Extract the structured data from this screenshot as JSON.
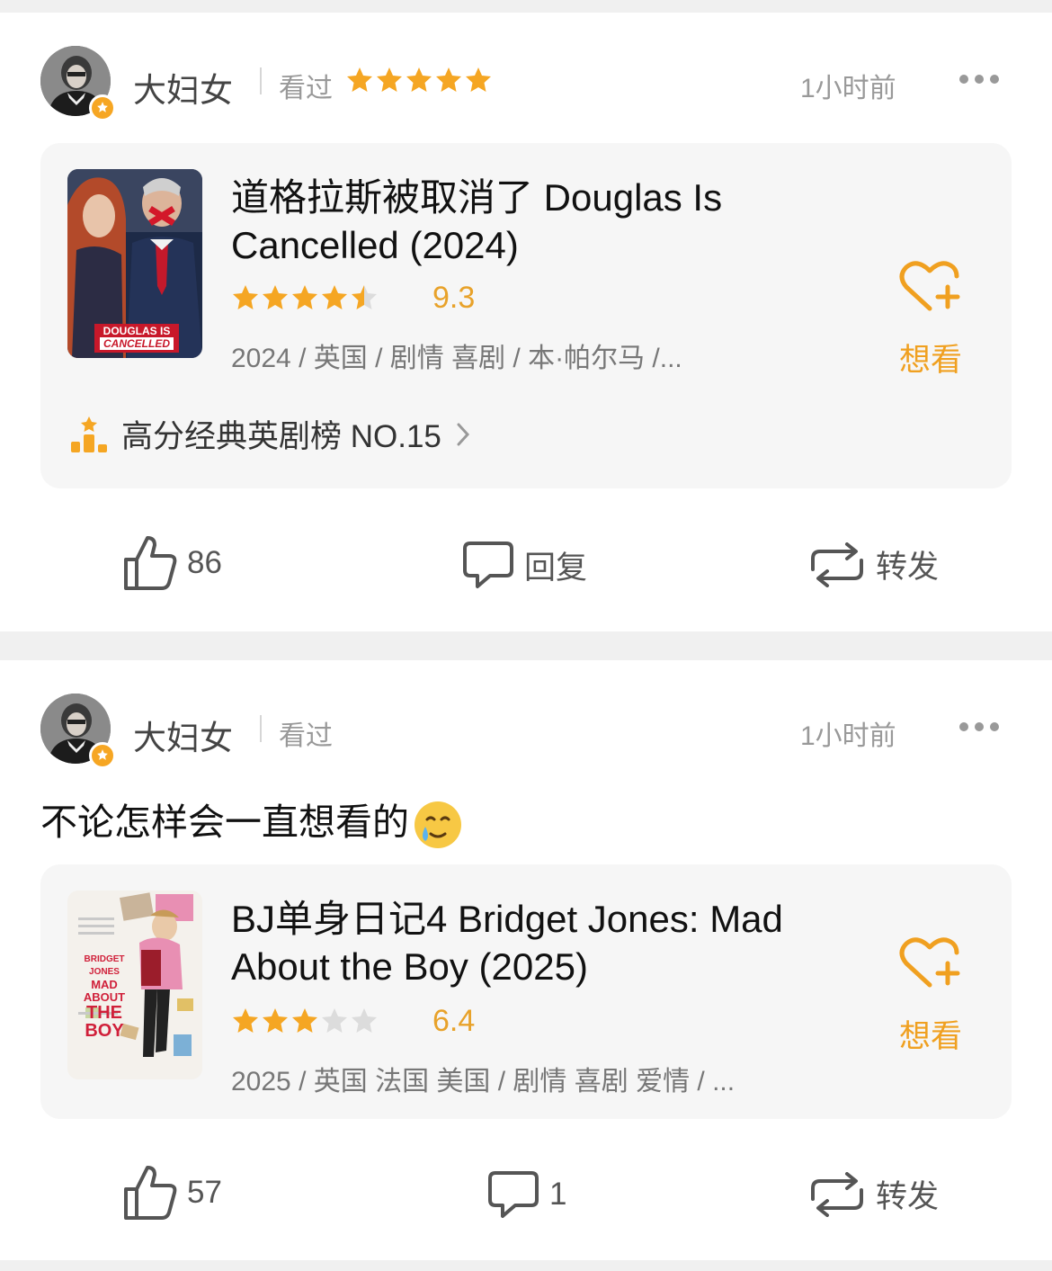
{
  "posts": [
    {
      "user": "大妇女",
      "status": "看过",
      "time": "1小时前",
      "star_rating": 5,
      "comment": "",
      "movie": {
        "title": "道格拉斯被取消了 Douglas Is Cancelled (2024)",
        "score": "9.3",
        "stars": 4.5,
        "meta": "2024 / 英国 / 剧情 喜剧 / 本·帕尔马 /...",
        "want_label": "想看",
        "poster_text_line1": "DOUGLAS IS",
        "poster_text_line2": "CANCELLED"
      },
      "rank": "高分经典英剧榜 NO.15",
      "likes": "86",
      "reply_label": "回复",
      "share_label": "转发"
    },
    {
      "user": "大妇女",
      "status": "看过",
      "time": "1小时前",
      "comment": "不论怎样会一直想看的",
      "movie": {
        "title": "BJ单身日记4 Bridget Jones: Mad About the Boy (2025)",
        "score": "6.4",
        "stars": 3,
        "meta": "2025 / 英国 法国 美国 / 剧情 喜剧 爱情 / ...",
        "want_label": "想看",
        "poster_text_line1": "BRIDGET JONES",
        "poster_text_line2": "MAD ABOUT",
        "poster_text_line3": "THE BOY"
      },
      "likes": "57",
      "replies": "1",
      "share_label": "转发"
    }
  ],
  "colors": {
    "accent": "#f0a020",
    "star": "#f5a623",
    "star_empty": "#dcdcdc"
  },
  "icons": [
    "avatar",
    "badge-star-icon",
    "star-icon",
    "more-icon",
    "heart-plus-icon",
    "rank-icon",
    "chevron-right-icon",
    "thumbs-up-icon",
    "comment-icon",
    "repost-icon",
    "tear-smile-emoji"
  ]
}
